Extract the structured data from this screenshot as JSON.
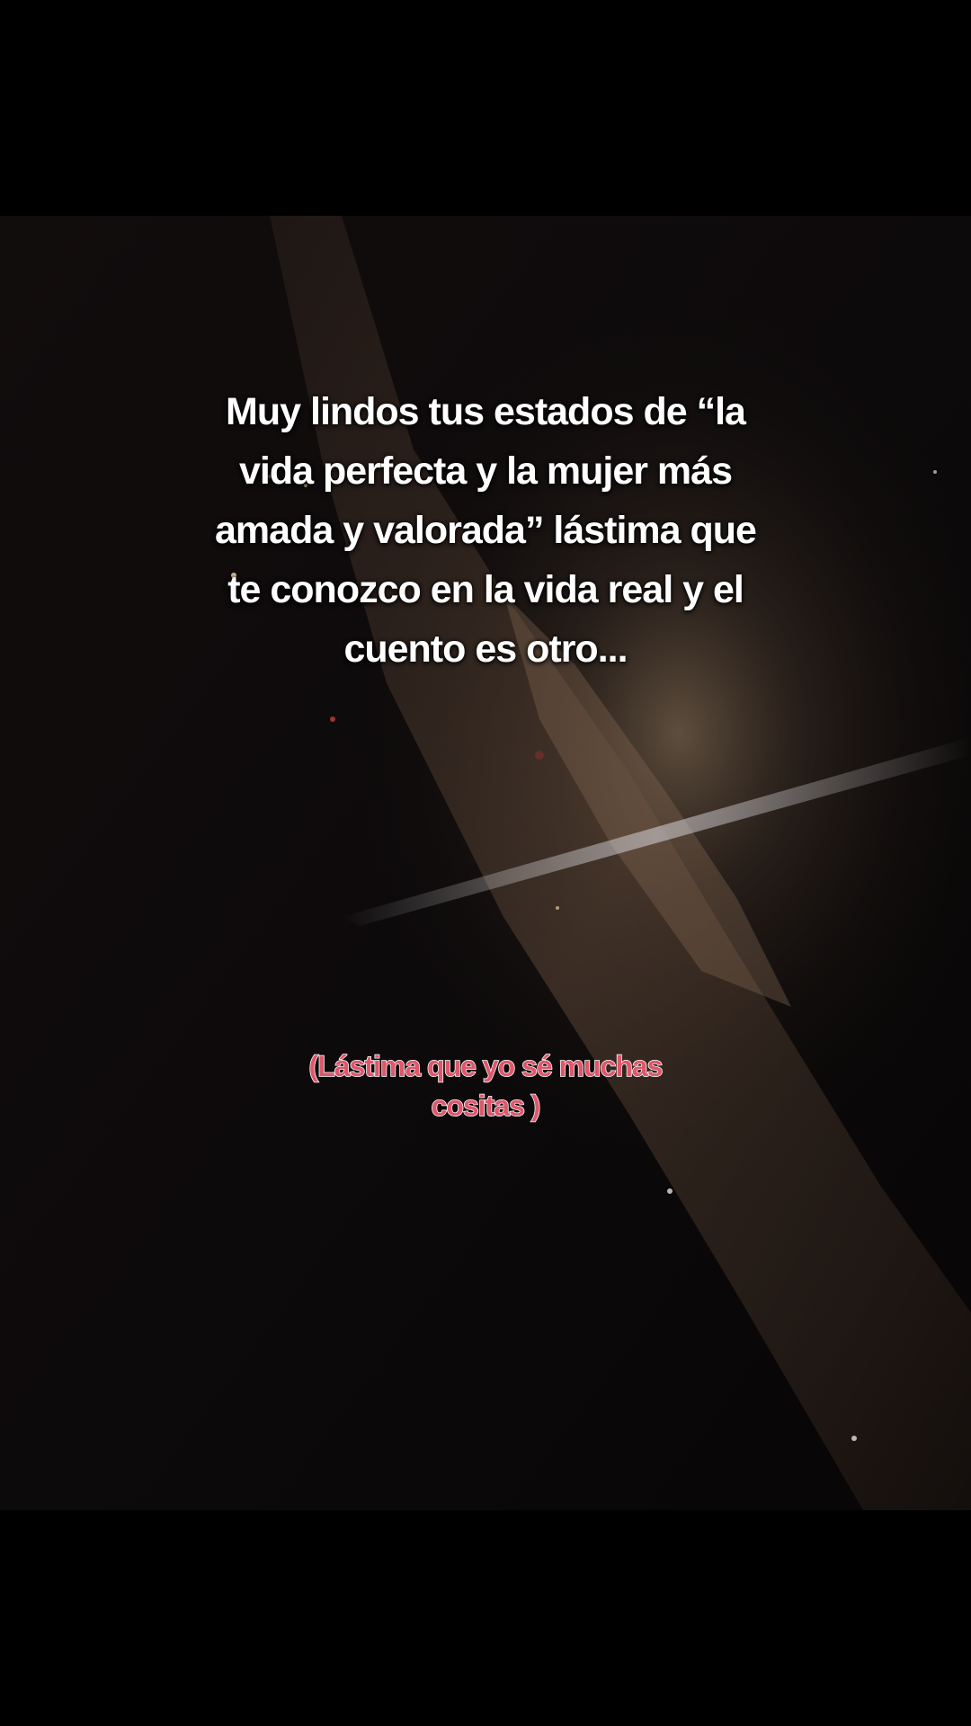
{
  "main_text": "Muy lindos tus estados de “la\nvida perfecta y la mujer más\namada y valorada” lástima que\nte conozco en la vida real y el\ncuento es otro...",
  "secondary_text": "(Lástima que yo sé muchas\ncositas )",
  "colors": {
    "background": "#000000",
    "main_text": "#ffffff",
    "secondary_text": "#e0566a",
    "secondary_outline": "#ffffff"
  }
}
